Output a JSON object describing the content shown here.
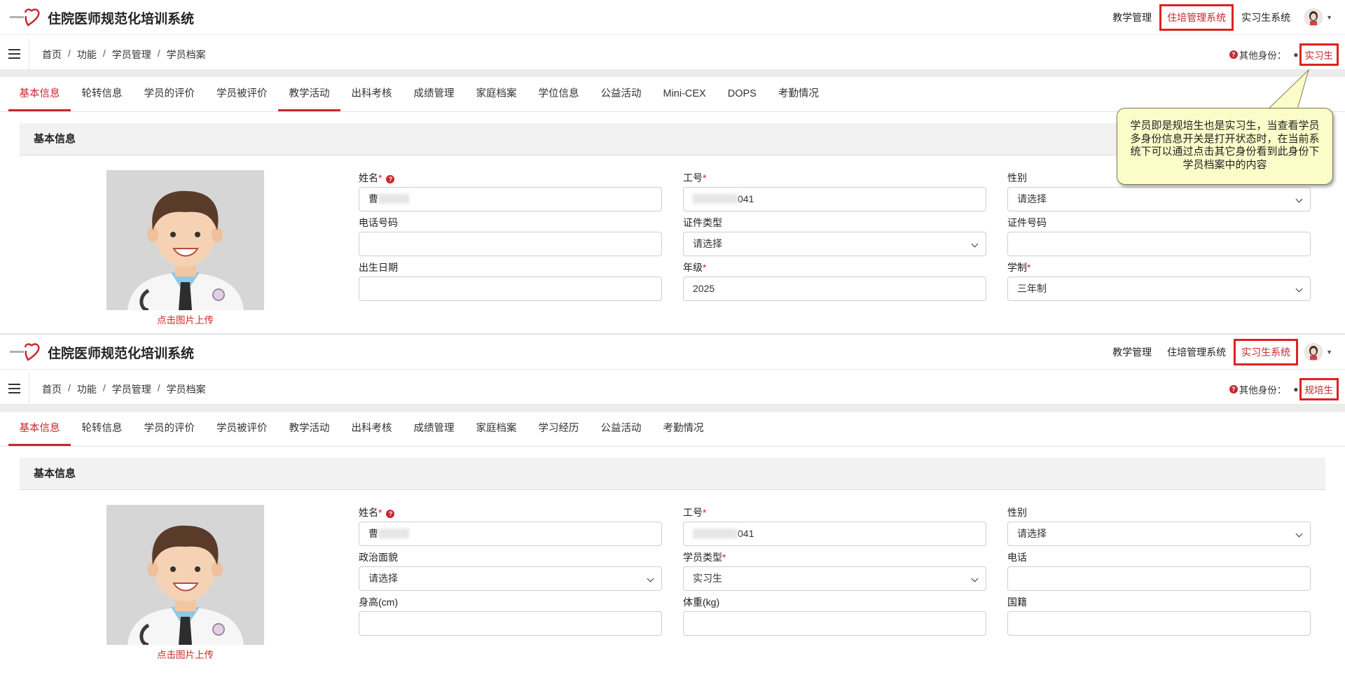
{
  "app_title": "住院医师规范化培训系统",
  "panels": [
    {
      "nav": [
        "教学管理",
        "住培管理系统",
        "实习生系统"
      ],
      "active_nav": 1,
      "breadcrumb": [
        "首页",
        "功能",
        "学员管理",
        "学员档案"
      ],
      "identity_label": "其他身份：",
      "identity_value": "实习生",
      "tabs": [
        "基本信息",
        "轮转信息",
        "学员的评价",
        "学员被评价",
        "教学活动",
        "出科考核",
        "成绩管理",
        "家庭档案",
        "学位信息",
        "公益活动",
        "Mini-CEX",
        "DOPS",
        "考勤情况"
      ],
      "active_tab": 0,
      "underlined_tab": 4,
      "section_title": "基本信息",
      "upload_text": "点击图片上传",
      "fields": [
        {
          "label": "姓名",
          "required": true,
          "help": true,
          "value": "曹",
          "blur": true,
          "type": "text"
        },
        {
          "label": "工号",
          "required": true,
          "value": "041",
          "blur_prefix": true,
          "type": "text"
        },
        {
          "label": "性别",
          "required": false,
          "value": "请选择",
          "type": "select"
        },
        {
          "label": "电话号码",
          "required": false,
          "value": "",
          "type": "text"
        },
        {
          "label": "证件类型",
          "required": false,
          "value": "请选择",
          "type": "select"
        },
        {
          "label": "证件号码",
          "required": false,
          "value": "",
          "type": "text"
        },
        {
          "label": "出生日期",
          "required": false,
          "value": "",
          "type": "text"
        },
        {
          "label": "年级",
          "required": true,
          "value": "2025",
          "type": "text"
        },
        {
          "label": "学制",
          "required": true,
          "value": "三年制",
          "type": "select"
        }
      ],
      "callout": "学员即是规培生也是实习生，当查看学员多身份信息开关是打开状态时，在当前系统下可以通过点击其它身份看到此身份下学员档案中的内容"
    },
    {
      "nav": [
        "教学管理",
        "住培管理系统",
        "实习生系统"
      ],
      "active_nav": 2,
      "breadcrumb": [
        "首页",
        "功能",
        "学员管理",
        "学员档案"
      ],
      "identity_label": "其他身份：",
      "identity_value": "规培生",
      "tabs": [
        "基本信息",
        "轮转信息",
        "学员的评价",
        "学员被评价",
        "教学活动",
        "出科考核",
        "成绩管理",
        "家庭档案",
        "学习经历",
        "公益活动",
        "考勤情况"
      ],
      "active_tab": 0,
      "underlined_tab": -1,
      "section_title": "基本信息",
      "upload_text": "点击图片上传",
      "fields": [
        {
          "label": "姓名",
          "required": true,
          "help": true,
          "value": "曹",
          "blur": true,
          "type": "text"
        },
        {
          "label": "工号",
          "required": true,
          "value": "041",
          "blur_prefix": true,
          "type": "text"
        },
        {
          "label": "性别",
          "required": false,
          "value": "请选择",
          "type": "select"
        },
        {
          "label": "政治面貌",
          "required": false,
          "value": "请选择",
          "type": "select"
        },
        {
          "label": "学员类型",
          "required": true,
          "value": "实习生",
          "type": "select"
        },
        {
          "label": "电话",
          "required": false,
          "value": "",
          "type": "text"
        },
        {
          "label": "身高(cm)",
          "required": false,
          "value": "",
          "type": "text"
        },
        {
          "label": "体重(kg)",
          "required": false,
          "value": "",
          "type": "text"
        },
        {
          "label": "国籍",
          "required": false,
          "value": "",
          "type": "text"
        }
      ],
      "callout": ""
    }
  ],
  "colors": {
    "accent": "#c8262f",
    "highlight_box": "#e02020",
    "callout_bg": "#fcfcc9"
  },
  "icons": [
    "heart-logo-icon",
    "menu-icon",
    "question-circle-icon",
    "user-icon",
    "caret-down-icon",
    "doctor-avatar-image"
  ]
}
